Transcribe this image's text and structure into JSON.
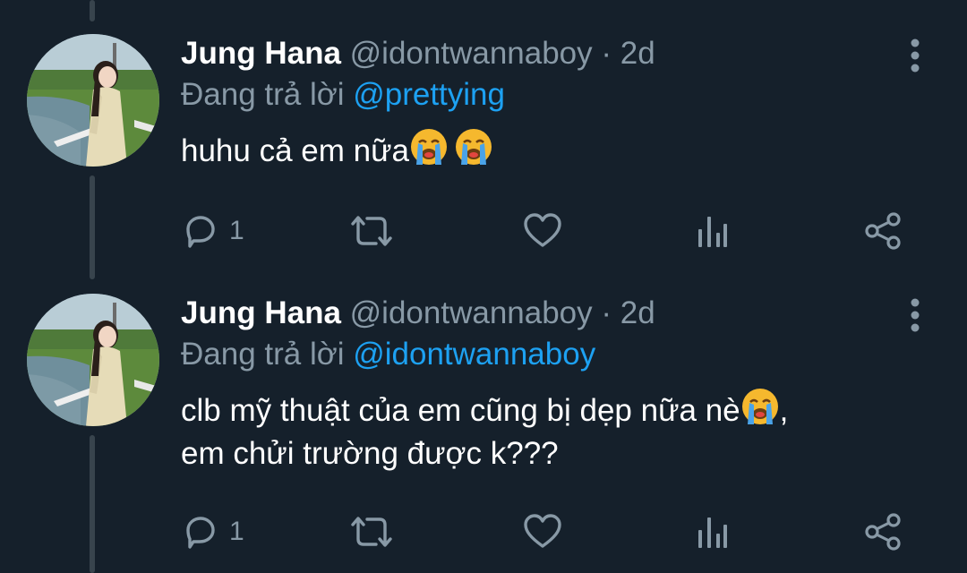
{
  "tweets": [
    {
      "name": "Jung Hana",
      "handle": "@idontwannaboy",
      "separator": "·",
      "time": "2d",
      "reply_prefix": "Đang trả lời",
      "reply_to": "@prettying",
      "text_line1": "huhu cả em nữa",
      "text_line1_emojis": [
        "loudly-crying-face-emoji",
        "loudly-crying-face-emoji"
      ],
      "text_line2": "",
      "reply_count": "1"
    },
    {
      "name": "Jung Hana",
      "handle": "@idontwannaboy",
      "separator": "·",
      "time": "2d",
      "reply_prefix": "Đang trả lời",
      "reply_to": "@idontwannaboy",
      "text_line1": "clb mỹ thuật của em cũng bị dẹp nữa nè",
      "text_line1_emojis": [
        "loudly-crying-face-emoji"
      ],
      "text_line1_suffix": ",",
      "text_line2": "em chửi trường được k???",
      "reply_count": "1"
    }
  ],
  "icons": {
    "reply": "reply-icon",
    "retweet": "retweet-icon",
    "like": "heart-icon",
    "analytics": "analytics-icon",
    "share": "share-icon",
    "menu": "more-vertical-icon"
  },
  "colors": {
    "background": "#15202b",
    "text": "#ffffff",
    "secondary": "#8899a6",
    "link": "#1da1f2",
    "thread_line": "#38444d"
  }
}
